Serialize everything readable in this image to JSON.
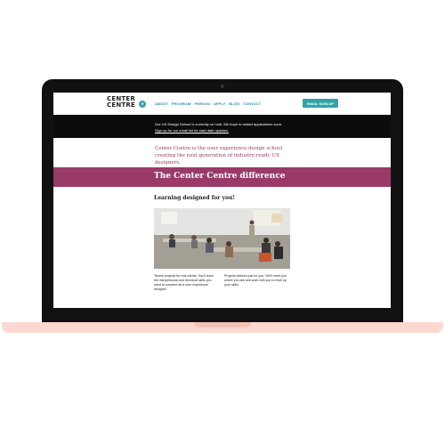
{
  "site": {
    "logo_line1": "CENTER",
    "logo_line2": "CENTRE",
    "nav": [
      "ABOUT",
      "PROGRAM",
      "PERSON",
      "APPLY",
      "BLOG",
      "CONTACT"
    ],
    "signup_label": "EMAIL SIGN-UP",
    "announcement": "Our UX Design School is currently on hold. We hope to restart applications soon.",
    "announcement_link": "Sign up for our email list for start date updates.",
    "tagline": "Center Centre is the user experience design school creating the next generation of industry-ready UX designers.",
    "band_title": "The Center Centre difference",
    "section_title": "Learning designed for you!",
    "caption_left": "Teams projects for real clients. You'll learn the interpersonal and technical skills you need to succeed as a user experience designer.",
    "caption_right": "Projects tailored just for you. We'll meet you where you are and work with you to level up your skills."
  },
  "colors": {
    "accent_purple": "#9a3a68",
    "teal": "#2ea4a8",
    "laptop_base": "#fbd8d0"
  }
}
